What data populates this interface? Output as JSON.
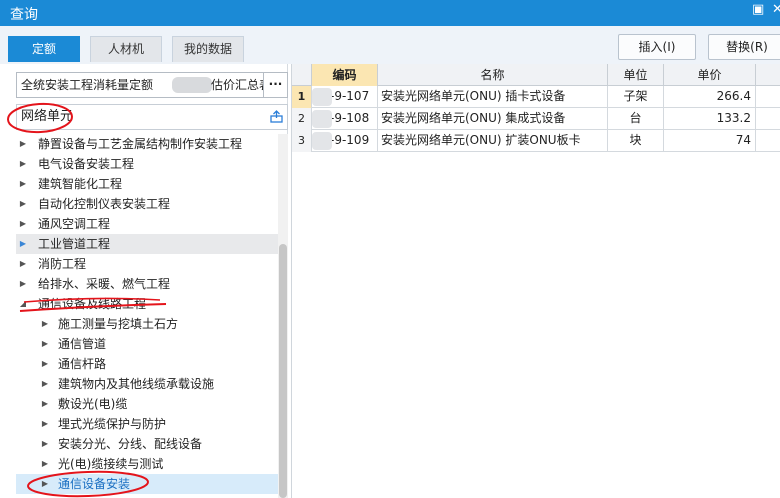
{
  "window": {
    "title": "查询",
    "restore_glyph": "▣",
    "close_glyph": "✕"
  },
  "tabs": [
    {
      "label": "定额"
    },
    {
      "label": "人材机"
    },
    {
      "label": "我的数据"
    }
  ],
  "actions": {
    "insert_label": "插入(I)",
    "replace_label": "替换(R)"
  },
  "library": {
    "value": "全统安装工程消耗量定额",
    "suffix": "估价汇总表",
    "more_label": "···"
  },
  "search": {
    "value": "网络单元"
  },
  "tree": [
    {
      "label": "静置设备与工艺金属结构制作安装工程",
      "expanded": false
    },
    {
      "label": "电气设备安装工程",
      "expanded": false
    },
    {
      "label": "建筑智能化工程",
      "expanded": false
    },
    {
      "label": "自动化控制仪表安装工程",
      "expanded": false
    },
    {
      "label": "通风空调工程",
      "expanded": false
    },
    {
      "label": "工业管道工程",
      "expanded": false
    },
    {
      "label": "消防工程",
      "expanded": false
    },
    {
      "label": "给排水、采暖、燃气工程",
      "expanded": false
    },
    {
      "label": "通信设备及线路工程",
      "expanded": true
    },
    {
      "label": "施工测量与挖填土石方",
      "expanded": false
    },
    {
      "label": "通信管道",
      "expanded": false
    },
    {
      "label": "通信杆路",
      "expanded": false
    },
    {
      "label": "建筑物内及其他线缆承载设施",
      "expanded": false
    },
    {
      "label": "敷设光(电)缆",
      "expanded": false
    },
    {
      "label": "埋式光缆保护与防护",
      "expanded": false
    },
    {
      "label": "安装分光、分线、配线设备",
      "expanded": false
    },
    {
      "label": "光(电)缆接续与测试",
      "expanded": false
    },
    {
      "label": "通信设备安装",
      "expanded": false
    }
  ],
  "table": {
    "headers": {
      "code": "编码",
      "name": "名称",
      "unit": "单位",
      "price": "单价"
    },
    "rows": [
      {
        "num": "1",
        "code": "-9-107",
        "name": "安装光网络单元(ONU) 插卡式设备",
        "unit": "子架",
        "price": "266.4"
      },
      {
        "num": "2",
        "code": "-9-108",
        "name": "安装光网络单元(ONU) 集成式设备",
        "unit": "台",
        "price": "133.2"
      },
      {
        "num": "3",
        "code": "-9-109",
        "name": "安装光网络单元(ONU) 扩装ONU板卡",
        "unit": "块",
        "price": "74"
      }
    ]
  },
  "colors": {
    "accent": "#1b8ad6",
    "annotation": "#e4141b",
    "sorted_header": "#fbe6b2",
    "selected_row": "#d7ebfa"
  }
}
